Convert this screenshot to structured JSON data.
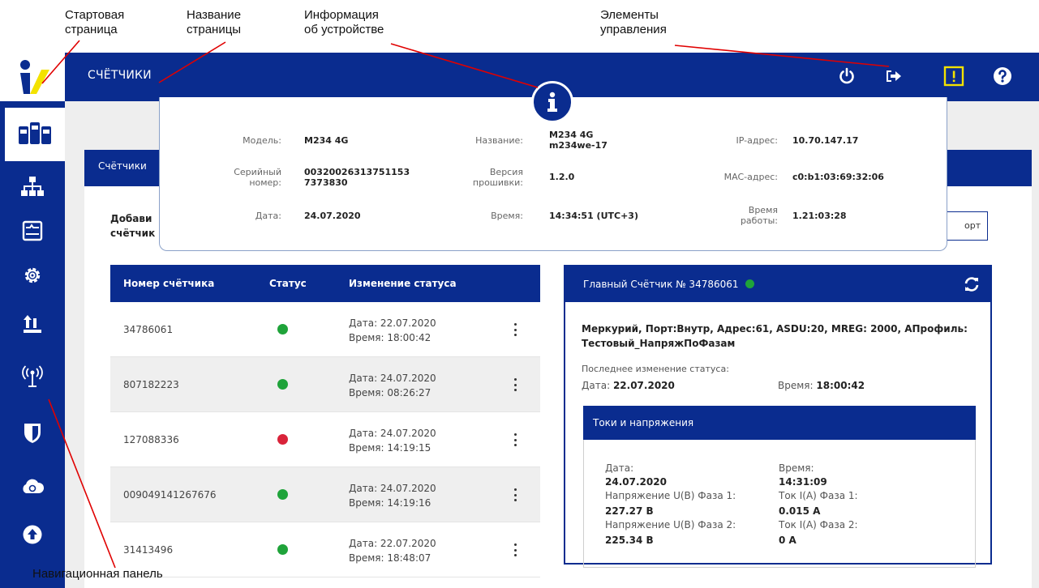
{
  "annotations": {
    "start_page": "Стартовая\nстраница",
    "page_name": "Название\nстраницы",
    "device_info": "Информация\nоб устройстве",
    "controls": "Элементы\nуправления",
    "nav_panel": "Навигационная панель"
  },
  "header": {
    "title": "СЧЁТЧИКИ"
  },
  "controls": [
    "power-icon",
    "logout-icon",
    "alert-icon",
    "help-icon"
  ],
  "sidebar": {
    "items": [
      {
        "name": "meters",
        "icon": "meters-icon",
        "active": true
      },
      {
        "name": "network",
        "icon": "network-icon"
      },
      {
        "name": "monitor",
        "icon": "monitor-icon"
      },
      {
        "name": "settings",
        "icon": "gear-icon"
      },
      {
        "name": "upload",
        "icon": "upload-icon"
      },
      {
        "name": "wireless",
        "icon": "antenna-icon"
      },
      {
        "name": "security",
        "icon": "shield-icon"
      },
      {
        "name": "cloud",
        "icon": "cloud-icon"
      },
      {
        "name": "update",
        "icon": "arrow-up-circle-icon"
      }
    ]
  },
  "panel": {
    "tab": "Счётчики",
    "add_label": "Добави\nсчётчик",
    "report_button": "орт"
  },
  "device_info": {
    "model_label": "Модель:",
    "model": "M234 4G",
    "name_label": "Название:",
    "name": "M234 4G\nm234we-17",
    "ip_label": "IP-адрес:",
    "ip": "10.70.147.17",
    "serial_label": "Серийный\nномер:",
    "serial": "00320026313751153\n7373830",
    "firmware_label": "Версия\nпрошивки:",
    "firmware": "1.2.0",
    "mac_label": "MAC-адрес:",
    "mac": "c0:b1:03:69:32:06",
    "date_label": "Дата:",
    "date": "24.07.2020",
    "time_label": "Время:",
    "time": "14:34:51 (UTC+3)",
    "uptime_label": "Время\nработы:",
    "uptime": "1.21:03:28"
  },
  "meters_table": {
    "headers": [
      "Номер счётчика",
      "Статус",
      "Изменение статуса"
    ],
    "rows": [
      {
        "number": "34786061",
        "status": "ok",
        "change": "Дата: 22.07.2020\nВремя: 18:00:42"
      },
      {
        "number": "807182223",
        "status": "ok",
        "change": "Дата: 24.07.2020\nВремя: 08:26:27"
      },
      {
        "number": "127088336",
        "status": "error",
        "change": "Дата: 24.07.2020\nВремя: 14:19:15"
      },
      {
        "number": "009049141267676",
        "status": "ok",
        "change": "Дата: 24.07.2020\nВремя: 14:19:16"
      },
      {
        "number": "31413496",
        "status": "ok",
        "change": "Дата: 22.07.2020\nВремя: 18:48:07"
      }
    ]
  },
  "colors": {
    "brand": "#0a2c8f",
    "ok": "#1fa33a",
    "error": "#d9233a",
    "alert": "#f3e200"
  },
  "main_meter": {
    "title": "Главный Счётчик № 34786061",
    "description": "Меркурий, Порт:Внутр, Адрес:61, ASDU:20, MREG: 2000, АПрофиль: Тестовый_НапряжПоФазам",
    "last_change_label": "Последнее изменение статуса:",
    "date_label": "Дата:",
    "date": "22.07.2020",
    "time_label": "Время:",
    "time": "18:00:42",
    "currents": {
      "title": "Токи и напряжения",
      "date_label": "Дата:",
      "date": "24.07.2020",
      "time_label": "Время:",
      "time": "14:31:09",
      "u1_label": "Напряжение U(В) Фаза 1:",
      "u1": "227.27 В",
      "i1_label": "Ток I(A) Фаза 1:",
      "i1": "0.015 A",
      "u2_label": "Напряжение U(В) Фаза 2:",
      "u2": "225.34 В",
      "i2_label": "Ток I(A) Фаза 2:",
      "i2": "0 A"
    }
  }
}
